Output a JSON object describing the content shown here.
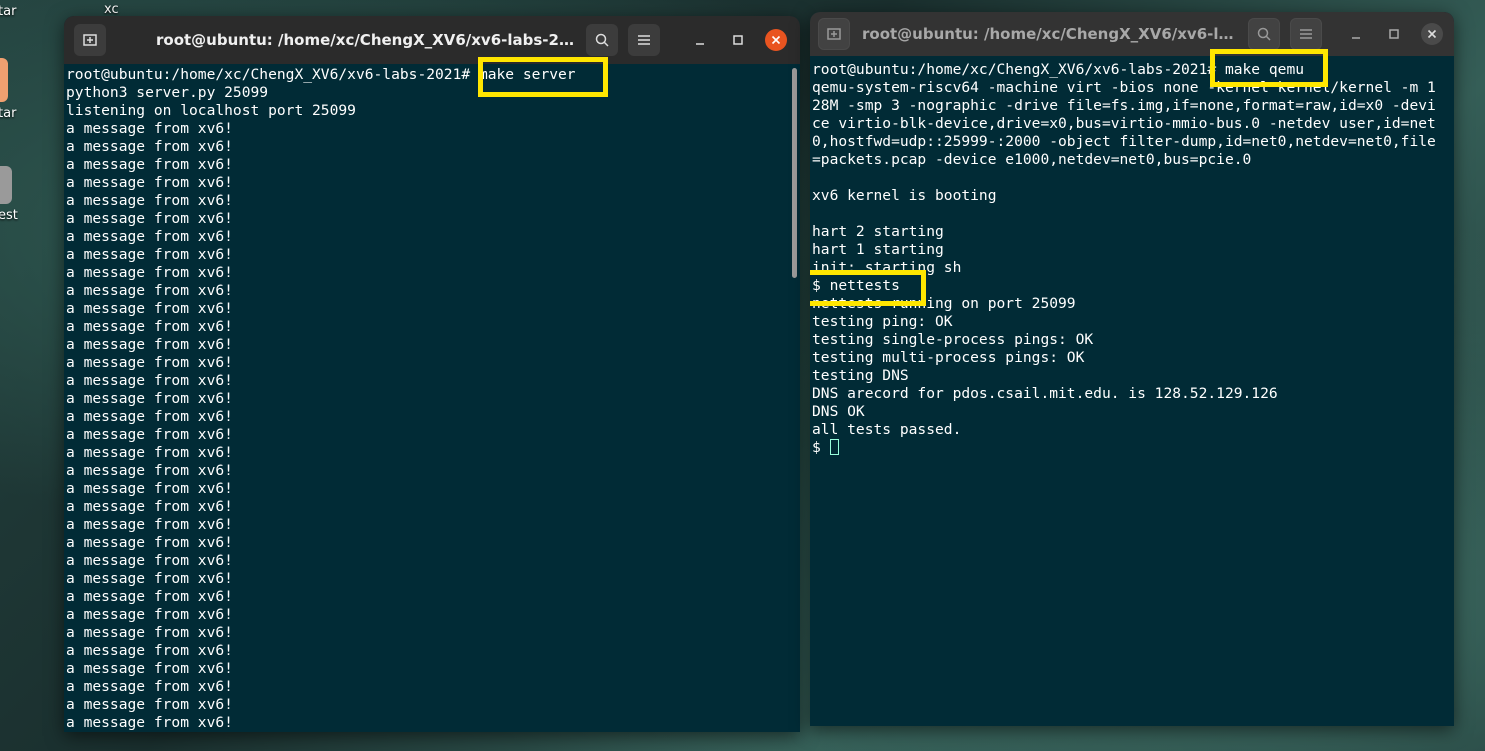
{
  "desktop": {
    "labels": [
      "xc",
      "tar",
      "est"
    ],
    "tar_partial": "tar"
  },
  "left_window": {
    "title": "root@ubuntu: /home/xc/ChengX_XV6/xv6-labs-2021",
    "lines": [
      "root@ubuntu:/home/xc/ChengX_XV6/xv6-labs-2021# make server",
      "python3 server.py 25099",
      "listening on localhost port 25099",
      "a message from xv6!",
      "a message from xv6!",
      "a message from xv6!",
      "a message from xv6!",
      "a message from xv6!",
      "a message from xv6!",
      "a message from xv6!",
      "a message from xv6!",
      "a message from xv6!",
      "a message from xv6!",
      "a message from xv6!",
      "a message from xv6!",
      "a message from xv6!",
      "a message from xv6!",
      "a message from xv6!",
      "a message from xv6!",
      "a message from xv6!",
      "a message from xv6!",
      "a message from xv6!",
      "a message from xv6!",
      "a message from xv6!",
      "a message from xv6!",
      "a message from xv6!",
      "a message from xv6!",
      "a message from xv6!",
      "a message from xv6!",
      "a message from xv6!",
      "a message from xv6!",
      "a message from xv6!",
      "a message from xv6!",
      "a message from xv6!",
      "a message from xv6!",
      "a message from xv6!",
      "a message from xv6!",
      "a message from xv6!"
    ]
  },
  "right_window": {
    "title": "root@ubuntu: /home/xc/ChengX_XV6/xv6-labs-...",
    "lines": [
      "root@ubuntu:/home/xc/ChengX_XV6/xv6-labs-2021# make qemu",
      "qemu-system-riscv64 -machine virt -bios none -kernel kernel/kernel -m 128M -smp 3 -nographic -drive file=fs.img,if=none,format=raw,id=x0 -device virtio-blk-device,drive=x0,bus=virtio-mmio-bus.0 -netdev user,id=net0,hostfwd=udp::25999-:2000 -object filter-dump,id=net0,netdev=net0,file=packets.pcap -device e1000,netdev=net0,bus=pcie.0",
      "",
      "xv6 kernel is booting",
      "",
      "hart 2 starting",
      "hart 1 starting",
      "init: starting sh",
      "$ nettests",
      "nettests running on port 25099",
      "testing ping: OK",
      "testing single-process pings: OK",
      "testing multi-process pings: OK",
      "testing DNS",
      "DNS arecord for pdos.csail.mit.edu. is 128.52.129.126",
      "DNS OK",
      "all tests passed."
    ],
    "prompt": "$ "
  },
  "colors": {
    "terminal_bg": "#012b36",
    "highlight": "#ffe600",
    "close_button": "#e95420"
  }
}
